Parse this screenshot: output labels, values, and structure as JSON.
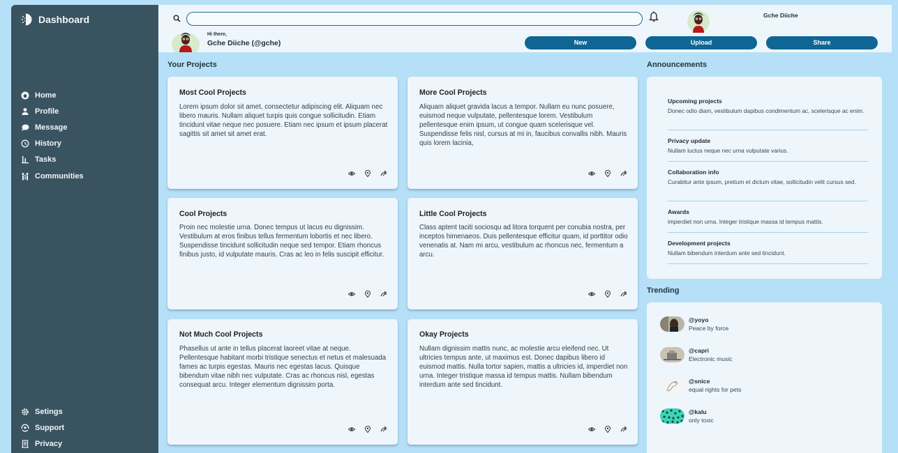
{
  "brand": {
    "title": "Dashboard"
  },
  "nav": {
    "top": [
      {
        "label": "Home",
        "icon": "home-icon"
      },
      {
        "label": "Profile",
        "icon": "profile-icon"
      },
      {
        "label": "Message",
        "icon": "message-icon"
      },
      {
        "label": "History",
        "icon": "history-icon"
      },
      {
        "label": "Tasks",
        "icon": "tasks-icon"
      },
      {
        "label": "Communities",
        "icon": "communities-icon"
      }
    ],
    "bottom": [
      {
        "label": "Setings",
        "icon": "gear-icon"
      },
      {
        "label": "Support",
        "icon": "support-icon"
      },
      {
        "label": "Privacy",
        "icon": "privacy-icon"
      }
    ]
  },
  "header": {
    "search_placeholder": "",
    "username": "Gche Diiche",
    "greeting": "Hi there,",
    "greeting_name": "Gche Diiche (@gche)",
    "buttons": {
      "new": "New",
      "upload": "Upload",
      "share": "Share"
    }
  },
  "sections": {
    "projects": "Your Projects",
    "announcements": "Announcements",
    "trending": "Trending"
  },
  "projects": [
    {
      "title": "Most Cool Projects",
      "body": "Lorem ipsum dolor sit amet, consectetur adipiscing elit. Aliquam nec libero mauris. Nullam aliquet turpis quis congue sollicitudin. Etiam tincidunt vitae neque nec posuere. Etiam nec ipsum et ipsum placerat sagittis sit amet sit amet erat."
    },
    {
      "title": "More Cool Projects",
      "body": "Aliquam aliquet gravida lacus a tempor. Nullam eu nunc posuere, euismod neque vulputate, pellentesque lorem. Vestibulum pellentesque enim ipsum, ut congue quam scelerisque vel. Suspendisse felis nisl, cursus at mi in, faucibus convallis nibh. Mauris quis lorem lacinia,"
    },
    {
      "title": "Cool Projects",
      "body": "Proin nec molestie urna. Donec tempus ut lacus eu dignissim. Vestibulum at eros finibus tellus fermentum lobortis et nec libero. Suspendisse tincidunt sollicitudin neque sed tempor. Etiam rhoncus finibus justo, id vulputate mauris. Cras ac leo in felis suscipit efficitur."
    },
    {
      "title": "Little Cool Projects",
      "body": "Class aptent taciti sociosqu ad litora torquent per conubia nostra, per inceptos himenaeos. Duis pellentesque efficitur quam, id porttitor odio venenatis at. Nam mi arcu, vestibulum ac rhoncus nec, fermentum a arcu."
    },
    {
      "title": "Not Much Cool Projects",
      "body": "Phasellus ut ante in tellus placerat laoreet vitae at neque. Pellentesque habitant morbi tristique senectus et netus et malesuada fames ac turpis egestas. Mauris nec egestas lacus. Quisque bibendum vitae nibh nec vulputate. Cras ac rhoncus nisl, egestas consequat arcu. Integer elementum dignissim porta."
    },
    {
      "title": "Okay Projects",
      "body": "Nullam dignissim mattis nunc, ac molestie arcu eleifend nec. Ut ultricies tempus ante, ut maximus est. Donec dapibus libero id euismod mattis. Nulla tortor sapien, mattis a ultricies id, imperdiet non urna. Integer tristique massa id tempus mattis. Nullam bibendum interdum ante sed tincidunt."
    }
  ],
  "announcements": [
    {
      "title": "Upcoming projects",
      "text": "Donec odio diam, vestibulum dapibus condimentum ac, scelerisque ac enim."
    },
    {
      "title": "Privacy update",
      "text": "Nullam luctus neque nec urna vulputate varius."
    },
    {
      "title": "Collaboration info",
      "text": "Curabitur ante ipsum, pretium et dictum vitae, sollicitudin velit cursus sed."
    },
    {
      "title": "Awards",
      "text": "imperdiet non urna. Integer tristique massa id tempus mattis."
    },
    {
      "title": "Development projects",
      "text": "Nullam bibendum interdum ante sed tincidunt."
    }
  ],
  "trending": [
    {
      "handle": "@yoyo",
      "desc": "Peace by force"
    },
    {
      "handle": "@capri",
      "desc": "Electronic music"
    },
    {
      "handle": "@snice",
      "desc": "equal rights for pets"
    },
    {
      "handle": "@kalu",
      "desc": "only toxic"
    }
  ],
  "colors": {
    "page_bg": "#b6e0f7",
    "sidebar_bg": "#3a5361",
    "accent": "#0f6694",
    "panel_bg": "#eef6fc",
    "divider": "#99d5ec"
  }
}
